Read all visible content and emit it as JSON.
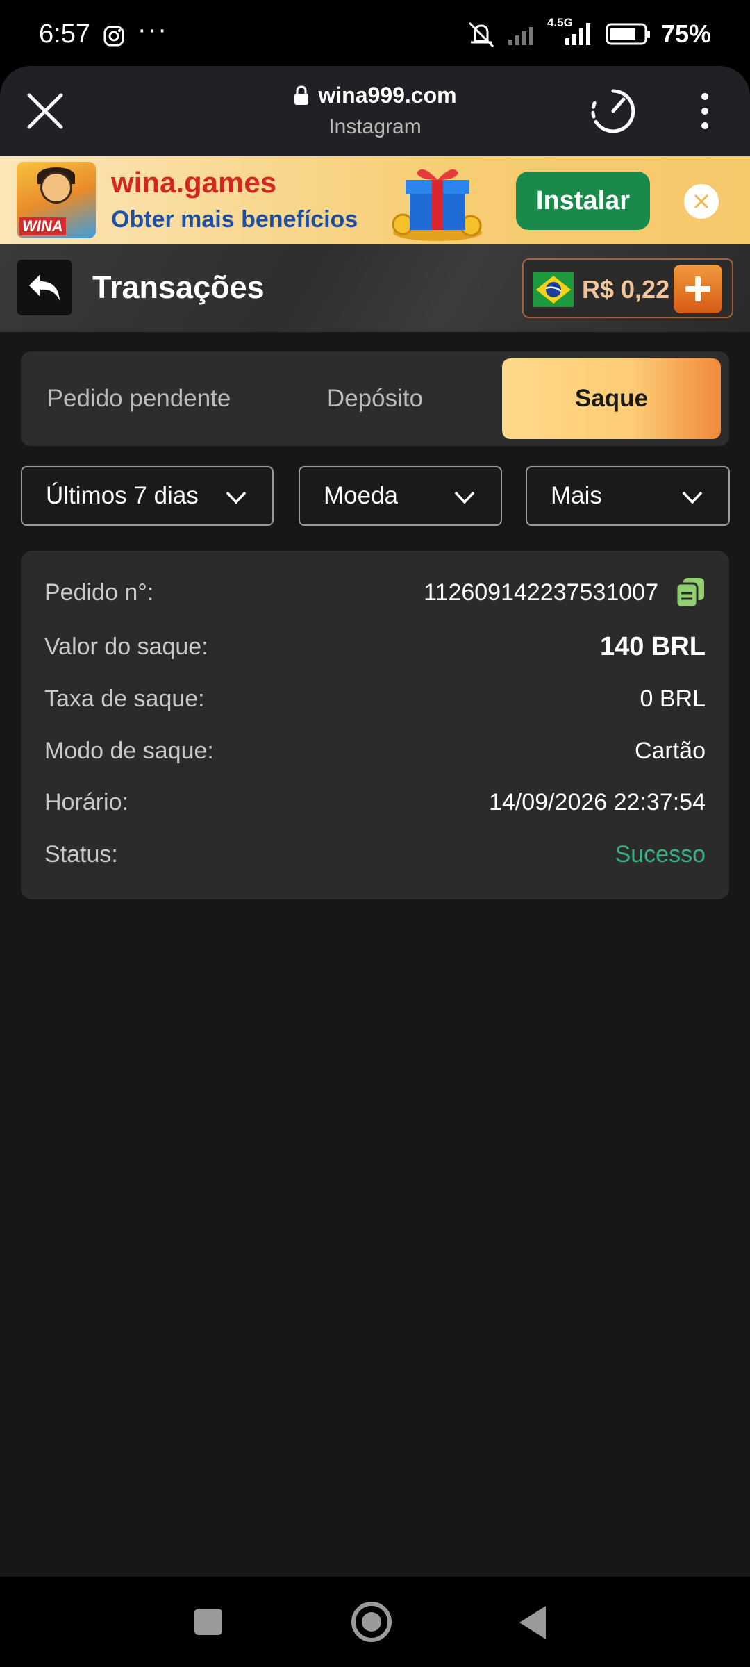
{
  "status_bar": {
    "time": "6:57",
    "network_label": "4.5G",
    "battery": "75%",
    "icons": [
      "instagram-icon",
      "more-dots-icon",
      "mute-icon",
      "signal-icon",
      "battery-icon"
    ]
  },
  "browser": {
    "url": "wina999.com",
    "source": "Instagram",
    "icons": [
      "close-icon",
      "lock-icon",
      "speed-icon",
      "kebab-menu-icon"
    ]
  },
  "banner": {
    "title": "wina.games",
    "subtitle": "Obter mais benefícios",
    "logo_text": "WINA",
    "install_label": "Instalar",
    "icons": [
      "gift-icon",
      "close-icon"
    ]
  },
  "header": {
    "title": "Transações",
    "balance": "R$ 0,22",
    "icons": [
      "back-arrow-icon",
      "brazil-flag-icon",
      "plus-icon"
    ]
  },
  "tabs": [
    {
      "label": "Pedido pendente",
      "active": false
    },
    {
      "label": "Depósito",
      "active": false
    },
    {
      "label": "Saque",
      "active": true
    }
  ],
  "filters": [
    {
      "label": "Últimos 7 dias"
    },
    {
      "label": "Moeda"
    },
    {
      "label": "Mais"
    }
  ],
  "transaction": {
    "order_label": "Pedido n°:",
    "order_value": "112609142237531007",
    "amount_label": "Valor do saque:",
    "amount_value": "140 BRL",
    "fee_label": "Taxa de saque:",
    "fee_value": "0 BRL",
    "mode_label": "Modo de saque:",
    "mode_value": "Cartão",
    "time_label": "Horário:",
    "time_value": "14/09/2026 22:37:54",
    "status_label": "Status:",
    "status_value": "Sucesso"
  },
  "colors": {
    "accent_orange": "#f08a3a",
    "success_green": "#36b37e",
    "copy_icon_green": "#8fcf6f",
    "background": "#181715"
  }
}
